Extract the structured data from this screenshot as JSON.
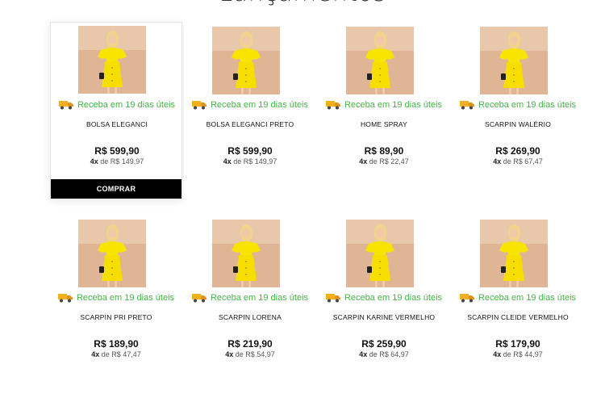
{
  "section": {
    "title": "Lançamentos"
  },
  "shipping_label": "Receba em 19 dias úteis",
  "buy_label": "COMPRAR",
  "colors": {
    "shipping_text": "#45b545",
    "buy_button_bg": "#000000",
    "thumb_dress": "#f5e000"
  },
  "products": [
    {
      "name": "BOLSA ELEGANCI",
      "price": "R$ 599,90",
      "installments_count": "4x",
      "installments_text": "de R$ 149,97",
      "highlighted": true
    },
    {
      "name": "BOLSA ELEGANCI PRETO",
      "price": "R$ 599,90",
      "installments_count": "4x",
      "installments_text": "de R$ 149,97"
    },
    {
      "name": "HOME SPRAY",
      "price": "R$ 89,90",
      "installments_count": "4x",
      "installments_text": "de R$ 22,47"
    },
    {
      "name": "SCARPIN WALÉRIO",
      "price": "R$ 269,90",
      "installments_count": "4x",
      "installments_text": "de R$ 67,47"
    },
    {
      "name": "SCARPIN PRI PRETO",
      "price": "R$ 189,90",
      "installments_count": "4x",
      "installments_text": "de R$ 47,47"
    },
    {
      "name": "SCARPIN LORENA",
      "price": "R$ 219,90",
      "installments_count": "4x",
      "installments_text": "de R$ 54,97"
    },
    {
      "name": "SCARPIN KARINE VERMELHO",
      "price": "R$ 259,90",
      "installments_count": "4x",
      "installments_text": "de R$ 64,97"
    },
    {
      "name": "SCARPIN CLEIDE VERMELHO",
      "price": "R$ 179,90",
      "installments_count": "4x",
      "installments_text": "de R$ 44,97"
    }
  ]
}
